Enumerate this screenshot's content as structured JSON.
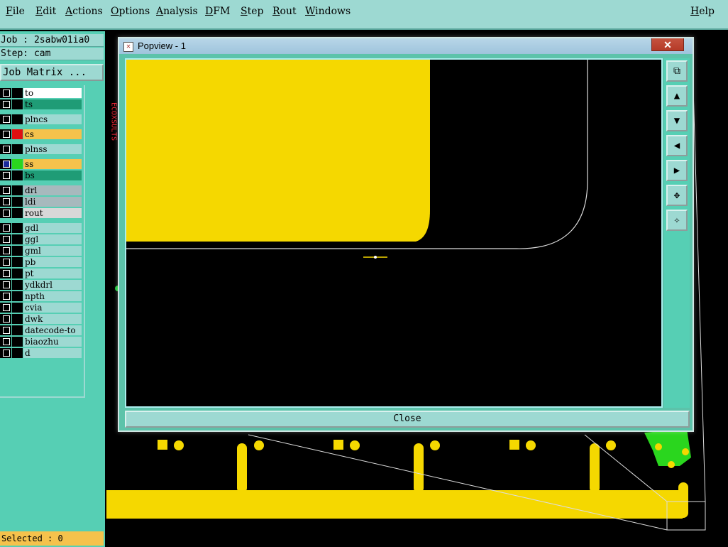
{
  "menubar": {
    "items": [
      "File",
      "Edit",
      "Actions",
      "Options",
      "Analysis",
      "DFM",
      "Step",
      "Rout",
      "Windows"
    ],
    "help": "Help"
  },
  "job": {
    "job_label": "Job : 2sabw01ia0",
    "step_label": "Step: cam",
    "matrix_button": "Job Matrix ..."
  },
  "layers": [
    {
      "name": "to",
      "bg": "#ffffff",
      "color": "#000000"
    },
    {
      "name": "ts",
      "bg": "#1f9c76",
      "color": "#000000"
    },
    {
      "name": "plncs",
      "bg": "#9dd9d2",
      "color": "#000000"
    },
    {
      "name": "cs",
      "bg": "#f5c24c",
      "color": "#e01010"
    },
    {
      "name": "plnss",
      "bg": "#9dd9d2",
      "color": "#000000"
    },
    {
      "name": "ss",
      "bg": "#f5c24c",
      "color": "#2ad61e",
      "checked": true
    },
    {
      "name": "bs",
      "bg": "#1f9c76",
      "color": "#000000"
    },
    {
      "name": "drl",
      "bg": "#a7b9bd",
      "color": "#000000"
    },
    {
      "name": "ldi",
      "bg": "#a7b9bd",
      "color": "#000000"
    },
    {
      "name": "rout",
      "bg": "#d8d8d8",
      "color": "#000000"
    },
    {
      "name": "gdl",
      "bg": "#9dd9d2",
      "color": "#000000"
    },
    {
      "name": "ggl",
      "bg": "#9dd9d2",
      "color": "#000000"
    },
    {
      "name": "gml",
      "bg": "#9dd9d2",
      "color": "#000000"
    },
    {
      "name": "pb",
      "bg": "#9dd9d2",
      "color": "#000000"
    },
    {
      "name": "pt",
      "bg": "#9dd9d2",
      "color": "#000000"
    },
    {
      "name": "ydkdrl",
      "bg": "#9dd9d2",
      "color": "#000000"
    },
    {
      "name": "npth",
      "bg": "#9dd9d2",
      "color": "#000000"
    },
    {
      "name": "cvia",
      "bg": "#9dd9d2",
      "color": "#000000"
    },
    {
      "name": "dwk",
      "bg": "#9dd9d2",
      "color": "#000000"
    },
    {
      "name": "datecode-to",
      "bg": "#9dd9d2",
      "color": "#000000"
    },
    {
      "name": "biaozhu",
      "bg": "#9dd9d2",
      "color": "#000000"
    },
    {
      "name": "d",
      "bg": "#9dd9d2",
      "color": "#000000"
    }
  ],
  "status": {
    "selected": "Selected : 0"
  },
  "popview": {
    "title": "Popview - 1",
    "close_x": "✕",
    "close_button": "Close",
    "tools": [
      "zoom-window-icon",
      "view-top-icon",
      "view-bottom-icon",
      "view-left-icon",
      "view-right-icon",
      "zoom-fit-icon",
      "zoom-home-icon"
    ]
  },
  "colors": {
    "panel": "#56cfb4",
    "menubar": "#9dd9d2",
    "copper": "#f5d800",
    "board": "#000000"
  }
}
